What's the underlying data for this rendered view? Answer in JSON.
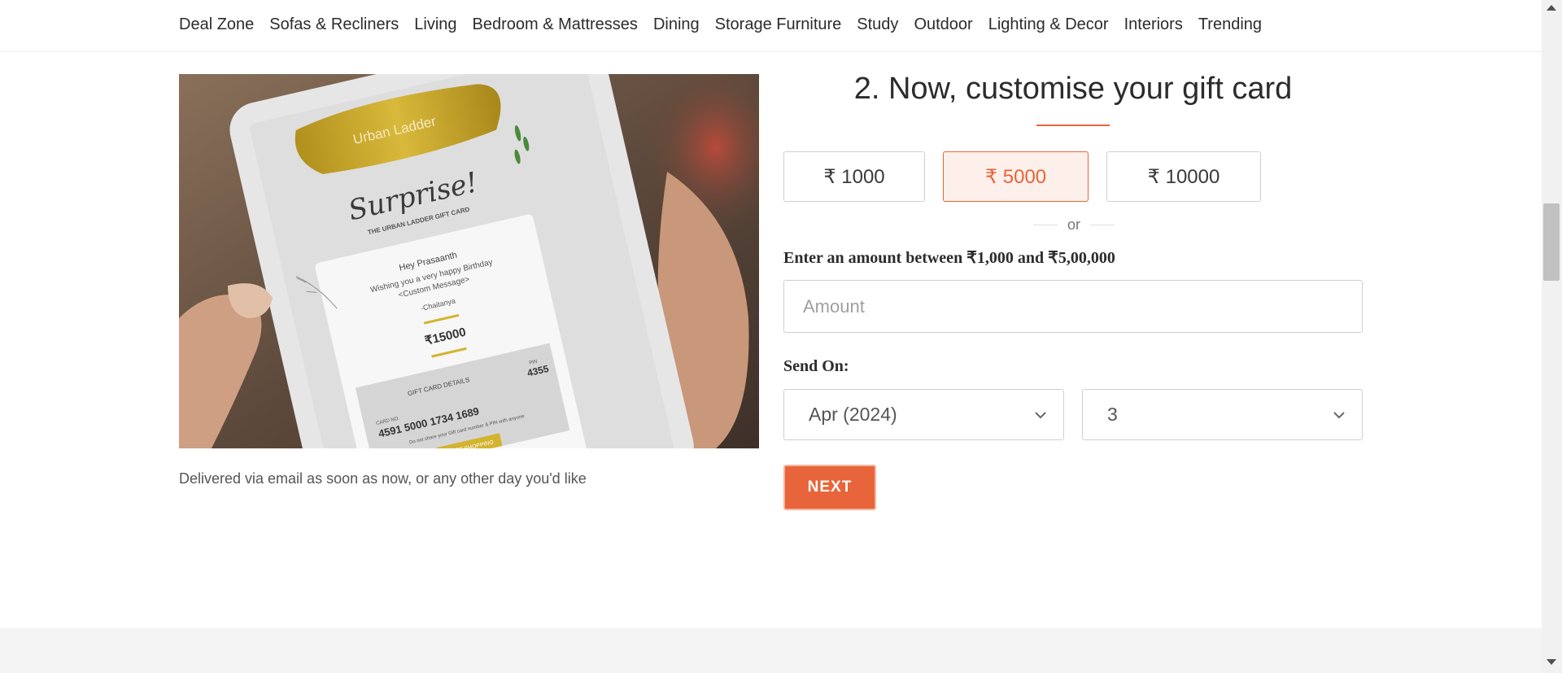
{
  "nav": {
    "items": [
      "Deal Zone",
      "Sofas & Recliners",
      "Living",
      "Bedroom & Mattresses",
      "Dining",
      "Storage Furniture",
      "Study",
      "Outdoor",
      "Lighting & Decor",
      "Interiors",
      "Trending"
    ]
  },
  "hero": {
    "brand": "Urban Ladder",
    "script_title": "Surprise!",
    "card_label": "THE URBAN LADDER GIFT CARD",
    "greeting": "Hey Prasaanth",
    "message_line1": "Wishing you a very happy Birthday",
    "message_line2": "<Custom Message>",
    "sender": "-Chaitanya",
    "card_amount": "₹15000",
    "details_label": "GIFT CARD DETAILS",
    "card_no_label": "CARD NO.",
    "card_number": "4591 5000 1734 1689",
    "pin_label": "PIN",
    "pin": "4355",
    "disclaimer": "Do not share your Gift card number & PIN with anyone",
    "cta": "START SHOPPING",
    "caption": "Delivered via email as soon as now, or any other day you'd like"
  },
  "form": {
    "title": "2. Now, customise your gift card",
    "amounts": [
      {
        "label": "₹ 1000",
        "selected": false
      },
      {
        "label": "₹ 5000",
        "selected": true
      },
      {
        "label": "₹ 10000",
        "selected": false
      }
    ],
    "or_text": "or",
    "amount_prompt": "Enter an amount between ₹1,000 and  ₹5,00,000",
    "amount_placeholder": "Amount",
    "send_on_label": "Send On:",
    "month_value": "Apr (2024)",
    "day_value": "3",
    "next_label": "NEXT"
  },
  "colors": {
    "accent": "#e8643a",
    "selected_bg": "#fdf0eb"
  }
}
